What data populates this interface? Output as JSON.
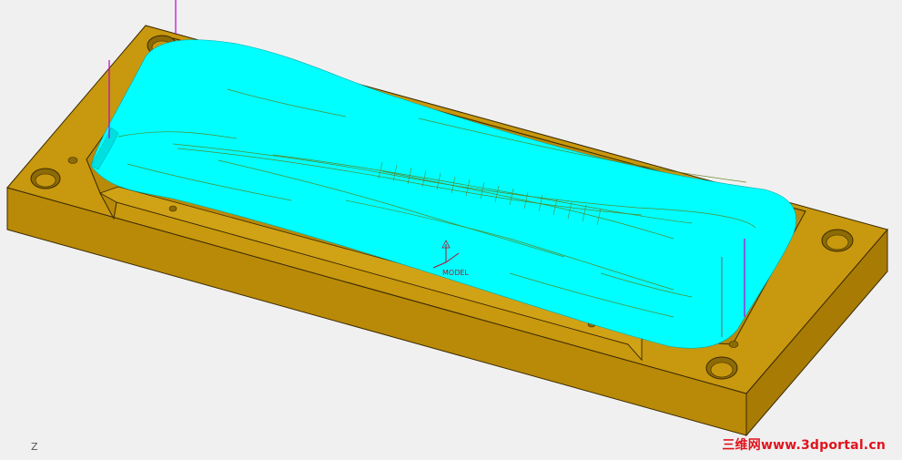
{
  "viewport": {
    "view_label": "Z",
    "csys_label": "MODEL",
    "watermark": "三维网www.3dportal.cn"
  },
  "colors": {
    "background": "#f0f0f0",
    "plate_top": "#c8980e",
    "plate_front": "#b98a08",
    "plate_side": "#a87b05",
    "edge": "#3a2a00",
    "toolpath": "#00ffff",
    "toolpath_lines": "#5a7a10",
    "tool_axis": "#c000d0",
    "watermark": "#e0141e"
  },
  "icons": [
    "coordinate-system-icon"
  ]
}
